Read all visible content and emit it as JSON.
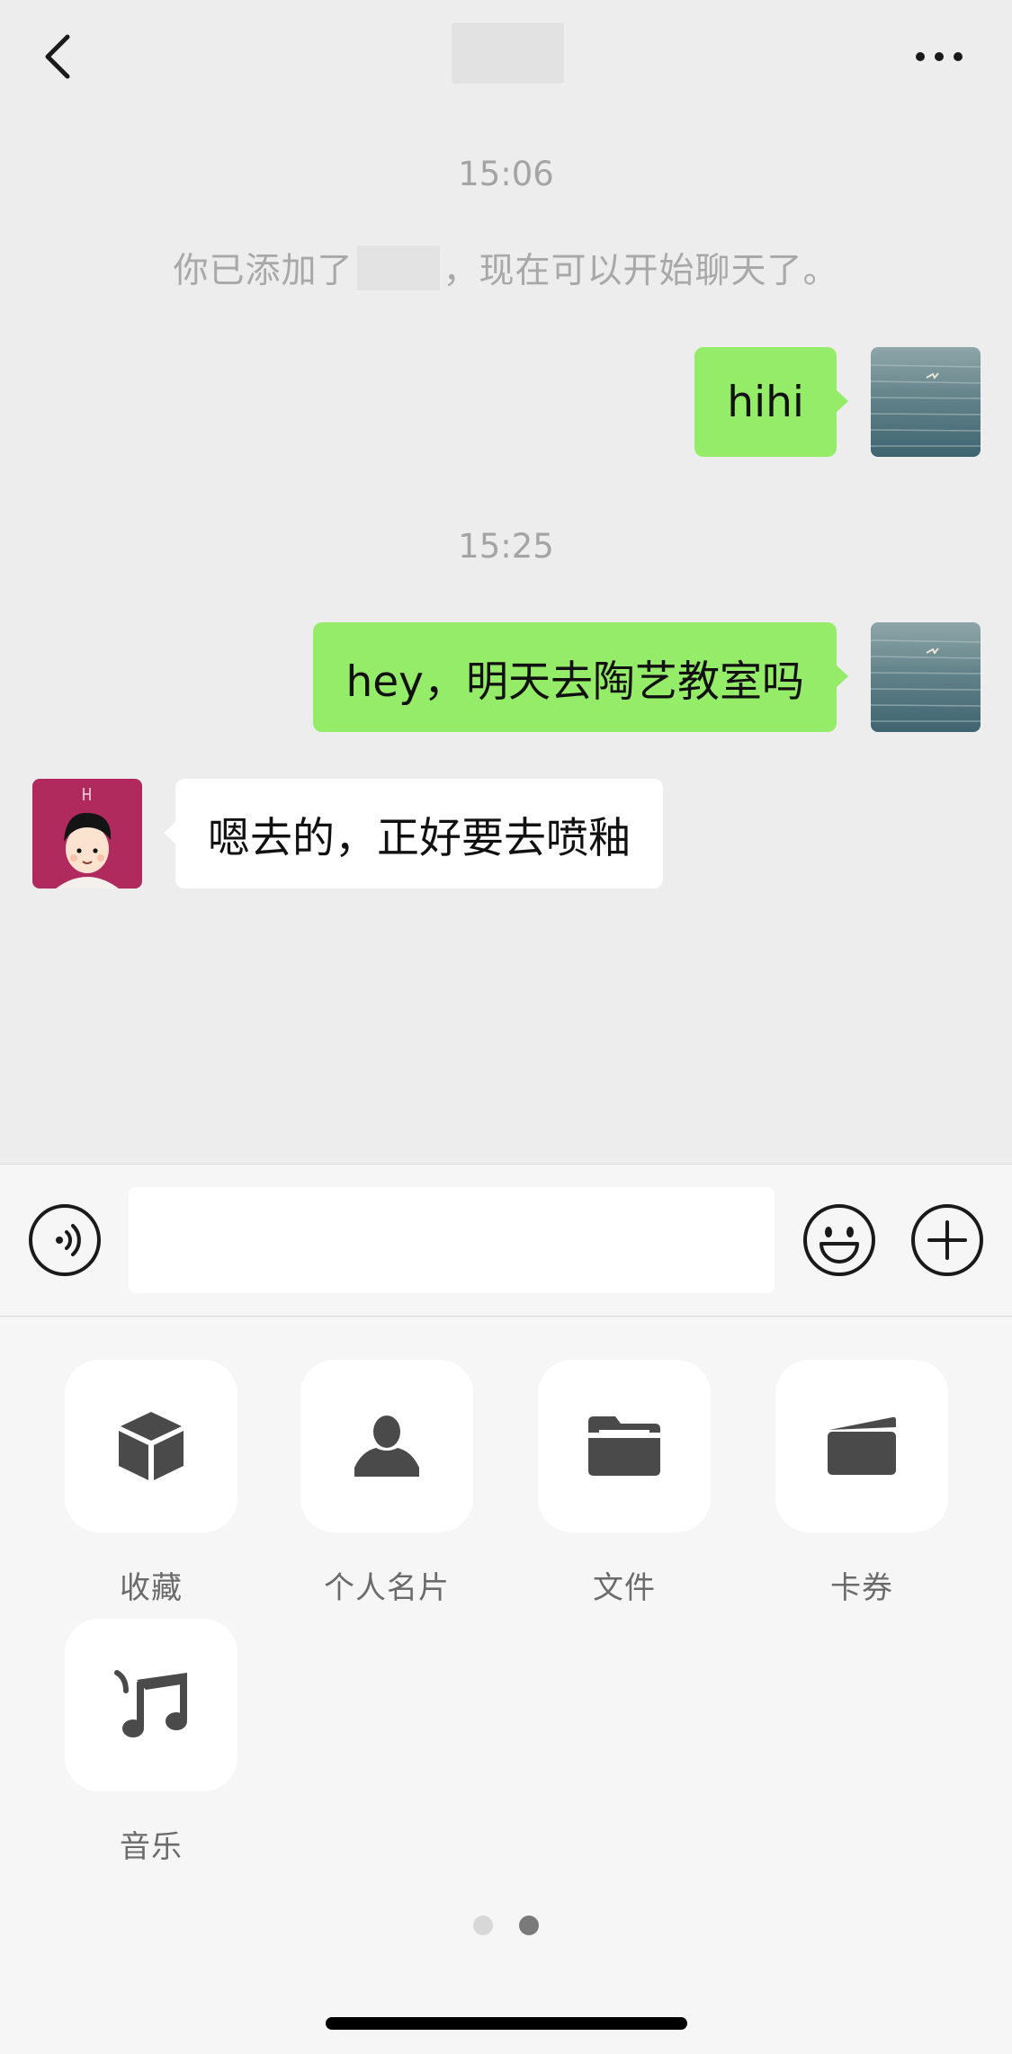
{
  "header": {
    "title": ""
  },
  "messages": {
    "time1": "15:06",
    "system_before": "你已添加了",
    "system_after": "，现在可以开始聊天了。",
    "msg1": "hihi",
    "time2": "15:25",
    "msg2": "hey，明天去陶艺教室吗",
    "msg3": "嗯去的，正好要去喷釉"
  },
  "input": {
    "value": "",
    "placeholder": ""
  },
  "tools": {
    "favorites": "收藏",
    "contact_card": "个人名片",
    "file": "文件",
    "coupons": "卡券",
    "music": "音乐"
  },
  "pager": {
    "current_page": 2,
    "total_pages": 2
  },
  "colors": {
    "my_bubble": "#95ec69",
    "their_bubble": "#ffffff",
    "background": "#ededed",
    "panel": "#f6f6f6",
    "icon": "#4a4a4a",
    "friend_avatar_bg": "#b02a5e"
  },
  "icons": {
    "back": "chevron-left-icon",
    "more": "ellipsis-icon",
    "voice": "voice-icon",
    "emoji": "emoji-icon",
    "plus": "plus-icon",
    "favorites": "cube-icon",
    "contact_card": "person-icon",
    "file": "folder-icon",
    "coupons": "wallet-icon",
    "music": "music-note-icon"
  }
}
